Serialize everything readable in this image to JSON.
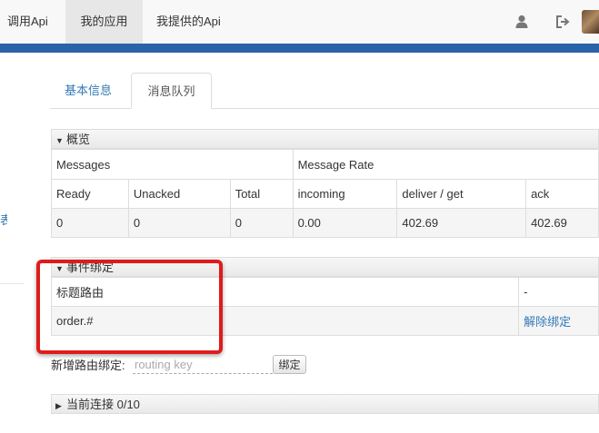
{
  "nav": {
    "items": [
      "调用Api",
      "我的应用",
      "我提供的Api"
    ],
    "active_index": 1,
    "icons": [
      "user-icon",
      "logout-icon"
    ]
  },
  "stray_left_text": "表",
  "tabs": [
    {
      "label": "基本信息",
      "active": false
    },
    {
      "label": "消息队列",
      "active": true
    }
  ],
  "overview": {
    "title": "概览",
    "group_headers": [
      "Messages",
      "Message Rate"
    ],
    "column_headers": [
      "Ready",
      "Unacked",
      "Total",
      "incoming",
      "deliver / get",
      "ack"
    ],
    "values": [
      "0",
      "0",
      "0",
      "0.00",
      "402.69",
      "402.69"
    ]
  },
  "bindings": {
    "title": "事件绑定",
    "header": [
      "标题路由",
      "-"
    ],
    "rows": [
      {
        "key": "order.#",
        "action": "解除绑定"
      }
    ]
  },
  "new_binding": {
    "label": "新增路由绑定:",
    "placeholder": "routing key",
    "button": "绑定"
  },
  "connections": {
    "title": "当前连接 0/10"
  },
  "colors": {
    "brand_bar": "#2b63a8",
    "link": "#337ab7",
    "annotation": "#e01b1b"
  }
}
